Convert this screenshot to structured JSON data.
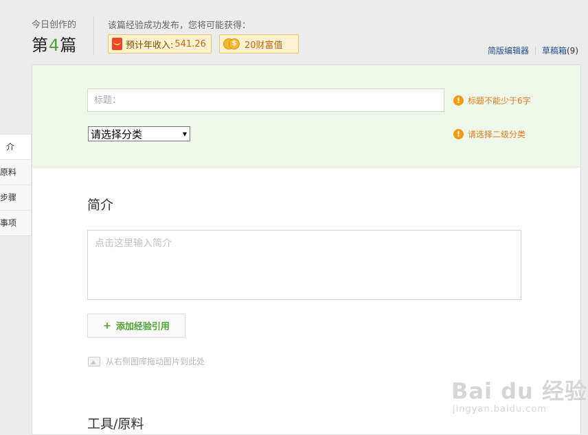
{
  "header": {
    "today_label": "今日创作的",
    "count_prefix": "第",
    "count_number": "4",
    "count_suffix": "篇",
    "reward_label": "该篇经验成功发布，您将可能获得：",
    "income_label": "预计年收入:",
    "income_value": "541.26",
    "wealth_label": "20财富值",
    "simple_editor_link": "简版编辑器",
    "drafts_link": "草稿箱",
    "drafts_count": "(9)"
  },
  "left_tabs": [
    "介",
    "原料",
    "步骤",
    "事项"
  ],
  "form": {
    "title_placeholder": "标题：",
    "title_warning": "标题不能少于6字",
    "category_value": "请选择分类",
    "category_warning": "请选择二级分类",
    "intro_heading": "简介",
    "intro_placeholder": "点击这里输入简介",
    "add_reference_label": "添加经验引用",
    "drag_hint": "从右侧图库拖动图片到此处",
    "tools_heading": "工具/原料"
  },
  "watermark": {
    "main": "Bai  du 经验",
    "sub": "jingyan.baidu.com"
  },
  "colors": {
    "accent_green": "#4aa52e",
    "warning_orange": "#e67a1a",
    "link_blue": "#1f4e8a",
    "top_panel_bg": "#eef8ea"
  }
}
